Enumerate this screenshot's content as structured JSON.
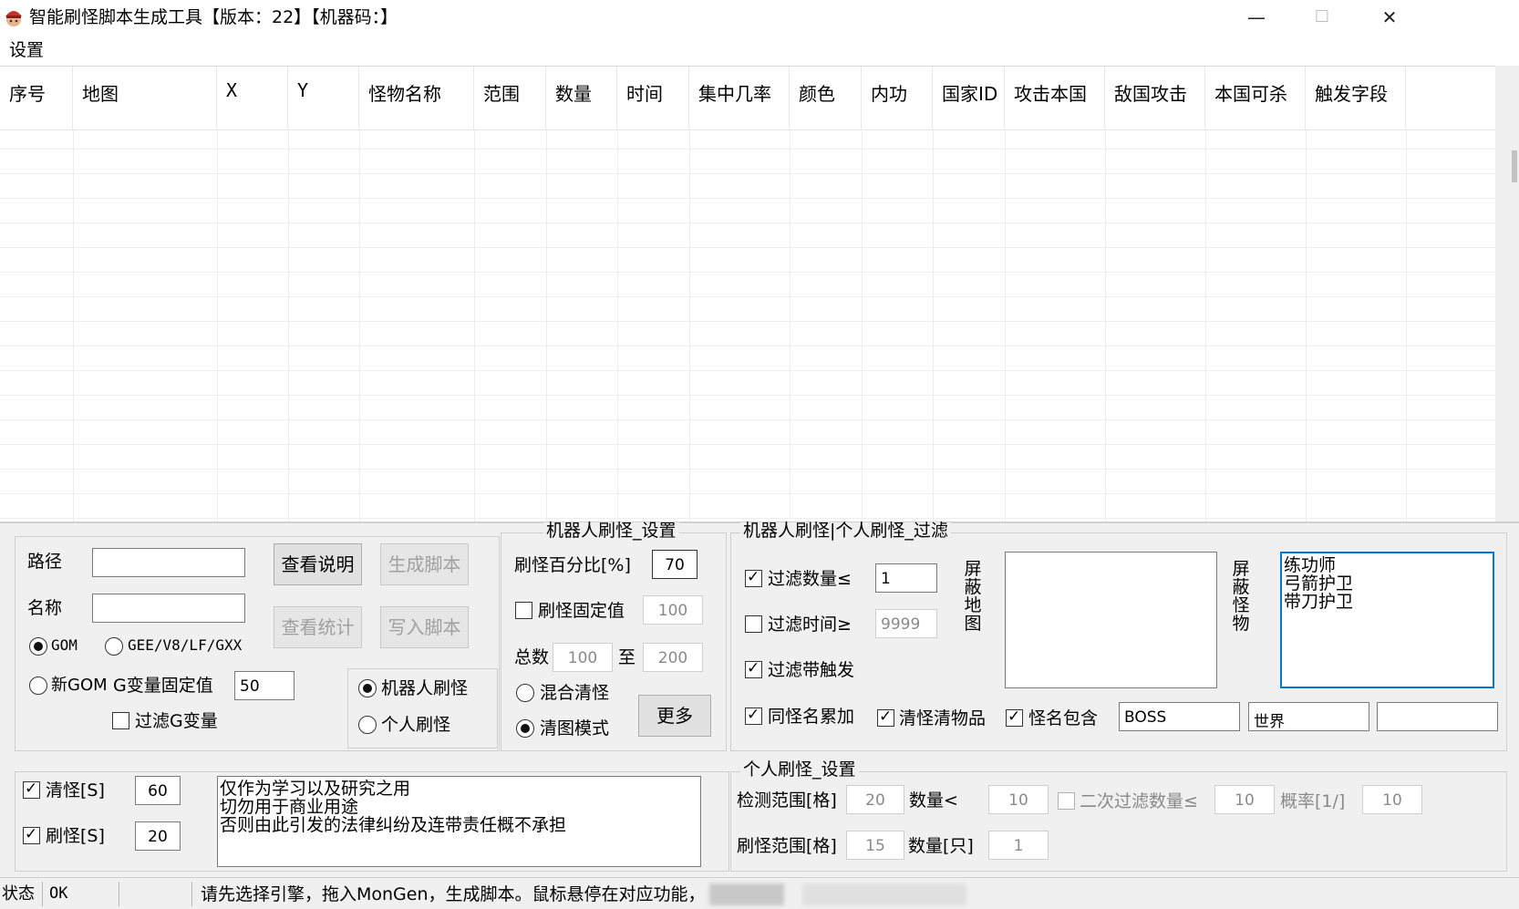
{
  "window": {
    "title": "智能刷怪脚本生成工具【版本：22】【机器码：】",
    "minimize": "—",
    "maximize": "☐",
    "close": "✕"
  },
  "menu": {
    "settings": "设置"
  },
  "table": {
    "columns": [
      "序号",
      "地图",
      "X",
      "Y",
      "怪物名称",
      "范围",
      "数量",
      "时间",
      "集中几率",
      "颜色",
      "内功",
      "国家ID",
      "攻击本国",
      "敌国攻击",
      "本国可杀",
      "触发字段"
    ]
  },
  "left": {
    "path_label": "路径",
    "path_value": "",
    "name_label": "名称",
    "name_value": "",
    "btn_view_help": "查看说明",
    "btn_generate": "生成脚本",
    "btn_view_stats": "查看统计",
    "btn_write": "写入脚本",
    "engine_gom": "GOM",
    "engine_gee": "GEE/V8/LF/GXX",
    "engine_newgom": "新GOM",
    "g_fixed_label": "G变量固定值",
    "g_fixed_value": "50",
    "filter_g": "过滤G变量",
    "mode_robot": "机器人刷怪",
    "mode_personal": "个人刷怪"
  },
  "robot_settings": {
    "legend": "机器人刷怪_设置",
    "percent_label": "刷怪百分比[%]",
    "percent_value": "70",
    "fixed_label": "刷怪固定值",
    "fixed_value": "100",
    "total_label": "总数",
    "total_from": "100",
    "to_label": "至",
    "total_to": "200",
    "mixed_clear": "混合清怪",
    "clear_map": "清图模式",
    "more_btn": "更多"
  },
  "filter": {
    "legend": "机器人刷怪|个人刷怪_过滤",
    "filter_count_label": "过滤数量≤",
    "filter_count_value": "1",
    "filter_time_label": "过滤时间≥",
    "filter_time_value": "9999",
    "filter_trigger": "过滤带触发",
    "block_map_label": "屏蔽地图",
    "block_monster_label": "屏蔽怪物",
    "block_monsters": [
      "练功师",
      "弓箭护卫",
      "带刀护卫"
    ],
    "same_name": "同怪名累加",
    "clear_items": "清怪清物品",
    "name_contains": "怪名包含",
    "contains_1": "BOSS",
    "contains_2": "世界",
    "contains_3": ""
  },
  "timers": {
    "clear_label": "清怪[S]",
    "clear_value": "60",
    "spawn_label": "刷怪[S]",
    "spawn_value": "20"
  },
  "notice": [
    "仅作为学习以及研究之用",
    "切勿用于商业用途",
    "否则由此引发的法律纠纷及连带责任概不承担"
  ],
  "personal": {
    "legend": "个人刷怪_设置",
    "detect_label": "检测范围[格]",
    "detect_value": "20",
    "count_lt_label": "数量<",
    "count_lt_value": "10",
    "second_filter_label": "二次过滤数量≤",
    "second_filter_value": "10",
    "prob_label": "概率[1/]",
    "prob_value": "10",
    "spawn_range_label": "刷怪范围[格]",
    "spawn_range_value": "15",
    "spawn_count_label": "数量[只]",
    "spawn_count_value": "1"
  },
  "status": {
    "label": "状态",
    "value": "OK",
    "message": "请先选择引擎，拖入MonGen，生成脚本。鼠标悬停在对应功能，"
  }
}
